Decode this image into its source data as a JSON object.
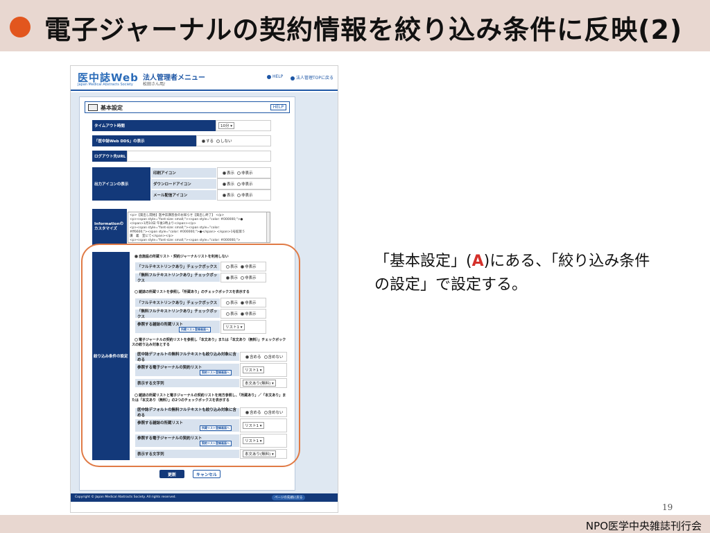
{
  "slide": {
    "title": "電子ジャーナルの契約情報を絞り込み条件に反映(2)",
    "caption_pre": "「基本設定」(",
    "caption_accent": "A",
    "caption_post": ")にある、「絞り込み条件の設定」で設定する。",
    "page_number": "19",
    "footer": "NPO医学中央雑誌刊行会",
    "accent_color": "#e2561e",
    "highlight_color": "#e07a45"
  },
  "app": {
    "logo": "医中誌Web",
    "logo_sub": "Japan Medical Abstracts Society",
    "menu_title": "法人管理者メニュー",
    "menu_sub": "松田さん用/",
    "help": "HELP",
    "top": "法人管理TOPに戻る"
  },
  "section": {
    "title": "基本設定",
    "help": "HELP"
  },
  "settings": {
    "timeout_label": "タイムアウト時間",
    "timeout_value": "10分",
    "dds_label": "「医中誌Web DDS」の表示",
    "dds_on": "する",
    "dds_off": "しない",
    "logout_label": "ログアウト先URL",
    "icon_label": "出力アイコンの表示",
    "icons": [
      {
        "name": "印刷アイコン",
        "show": "表示",
        "hide": "非表示"
      },
      {
        "name": "ダウンロードアイコン",
        "show": "表示",
        "hide": "非表示"
      },
      {
        "name": "メール配信アイコン",
        "show": "表示",
        "hide": "非表示"
      }
    ],
    "info_label": "Informationのカスタマイズ",
    "info_lines": [
      "<p>【発出し開始】医中誌講習会のお知らせ【発出し終了】 </p>",
      "<p><span style=\"font-size: small;\"><span style=\"color: #000000;\">●",
      "</span>1月10日 午後3時より</span></p>",
      "<p><span style=\"font-size: small;\"><span style=\"color:",
      "#ff6600;\"><span style=\"color: #000000;\">●</span> </span>1号館第５",
      "講　義　室にて</span></p>",
      "<p><span style=\"font-size: small;\"><span style=\"color: #000000;\">"
    ],
    "filter_label": "絞り込み条件の設定"
  },
  "filter": {
    "opt1": "自施設の所蔵リスト・契約ジャーナルリストを利用しない",
    "ft_link": "「フルテキストリンクあり」チェックボックス",
    "free_ft_link": "「無料フルテキストリンクあり」チェックボックス",
    "show": "表示",
    "hide": "非表示",
    "opt2": "雑誌の所蔵リストを参照し「所蔵あり」のチェックボックスを表示する",
    "ref_holdings": "参照する雑誌の所蔵リスト",
    "holdings_btn": "所蔵リスト登録画面へ",
    "list1": "リスト1",
    "opt3": "電子ジャーナルの契約リストを参照し「本文あり」または「本文あり（無料）」チェックボックスの絞り込み対象とする",
    "include_free": "医中誌デフォルトの無料フルテキストも絞り込み対象に含める",
    "include": "含める",
    "exclude": "含めない",
    "ref_ej": "参照する電子ジャーナルの契約リスト",
    "ej_btn": "契約リスト登録画面へ",
    "display_text": "表示する文字列",
    "display_value": "本文あり(無料)",
    "opt4": "雑誌の所蔵リストと電子ジャーナルの契約リストを両方参照し、「所蔵あり」／「本文あり」または「本文あり（無料）」の2つのチェックボックスを表示する"
  },
  "buttons": {
    "update": "更新",
    "cancel": "キャンセル"
  },
  "footer_app": {
    "copyright": "Copyright © Japan Medical Abstracts Society. All rights reserved.",
    "pagetop": "ページの先頭に戻る"
  }
}
